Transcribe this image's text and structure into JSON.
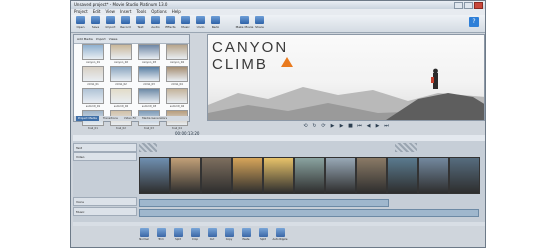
{
  "window": {
    "title": "Unsaved project* - Movie Studio Platinum 13.0"
  },
  "menu": [
    "Project",
    "Edit",
    "View",
    "Insert",
    "Tools",
    "Options",
    "Help"
  ],
  "toolbar": [
    {
      "label": "Open",
      "icon": "folder-icon"
    },
    {
      "label": "Save",
      "icon": "save-icon"
    },
    {
      "label": "Import",
      "icon": "import-icon"
    },
    {
      "label": "Record",
      "icon": "record-icon"
    },
    {
      "label": "Text",
      "icon": "text-icon"
    },
    {
      "label": "Audio",
      "icon": "audio-icon"
    },
    {
      "label": "Effects",
      "icon": "fx-icon"
    },
    {
      "label": "Music",
      "icon": "music-icon"
    },
    {
      "label": "Undo",
      "icon": "undo-icon"
    },
    {
      "label": "Redo",
      "icon": "redo-icon"
    },
    {
      "label": "Make Movie",
      "icon": "make-movie-icon"
    },
    {
      "label": "Share",
      "icon": "share-icon"
    }
  ],
  "library": {
    "toolbar": [
      "Add Media",
      "Import",
      "Views"
    ],
    "items": [
      {
        "caption": "canyon_01",
        "tone": "#8fb0cf"
      },
      {
        "caption": "canyon_02",
        "tone": "#c9b79a"
      },
      {
        "caption": "canyon_03",
        "tone": "#6e86a4"
      },
      {
        "caption": "canyon_04",
        "tone": "#b7a58c"
      },
      {
        "caption": "climb_01",
        "tone": "#d8d0c4"
      },
      {
        "caption": "climb_02",
        "tone": "#8ca6c0"
      },
      {
        "caption": "climb_03",
        "tone": "#5b7fa3"
      },
      {
        "caption": "climb_04",
        "tone": "#a68f73"
      },
      {
        "caption": "summit_01",
        "tone": "#b0c3d6"
      },
      {
        "caption": "summit_02",
        "tone": "#e2dcc8"
      },
      {
        "caption": "summit_03",
        "tone": "#6d8aa6"
      },
      {
        "caption": "summit_04",
        "tone": "#c4b39b"
      },
      {
        "caption": "trail_01",
        "tone": "#9fb4c8"
      },
      {
        "caption": "trail_02",
        "tone": "#d1c1a8"
      },
      {
        "caption": "trail_03",
        "tone": "#7e9bb8"
      },
      {
        "caption": "trail_04",
        "tone": "#b89e7d"
      }
    ],
    "tabs": [
      "Project Media",
      "Transitions",
      "Video FX",
      "Media Generators"
    ]
  },
  "preview": {
    "title_line1": "CANYON",
    "title_line2": "CLIMB"
  },
  "transport": [
    "⟲",
    "↻",
    "⟳",
    "▶",
    "▶",
    "■",
    "⏮",
    "◀",
    "▶",
    "⏭"
  ],
  "timecode": "00:00:13;20",
  "tracks": [
    {
      "name": "Text"
    },
    {
      "name": "Video"
    },
    {
      "name": "Voice"
    },
    {
      "name": "Music"
    }
  ],
  "clips": [
    {
      "tone": "#6f8fb0"
    },
    {
      "tone": "#c2a078"
    },
    {
      "tone": "#7d6e5e"
    },
    {
      "tone": "#d7a55a"
    },
    {
      "tone": "#e8c36a"
    },
    {
      "tone": "#8aa3a0"
    },
    {
      "tone": "#98a8b6"
    },
    {
      "tone": "#8a7a66"
    },
    {
      "tone": "#5a7a8e"
    },
    {
      "tone": "#73889e"
    },
    {
      "tone": "#566c7e"
    }
  ],
  "bottom_toolbar": [
    {
      "label": "Normal",
      "icon": "cursor-icon"
    },
    {
      "label": "Trim",
      "icon": "trim-icon"
    },
    {
      "label": "Split",
      "icon": "split-icon"
    },
    {
      "label": "Crop",
      "icon": "crop-icon"
    },
    {
      "label": "Cut",
      "icon": "scissors-icon"
    },
    {
      "label": "Copy",
      "icon": "copy-icon"
    },
    {
      "label": "Paste",
      "icon": "paste-icon"
    },
    {
      "label": "Split",
      "icon": "split-icon"
    },
    {
      "label": "Auto Ripple",
      "icon": "ripple-icon"
    }
  ],
  "colors": {
    "accent": "#2f62a8",
    "title_triangle": "#e97a1e"
  }
}
